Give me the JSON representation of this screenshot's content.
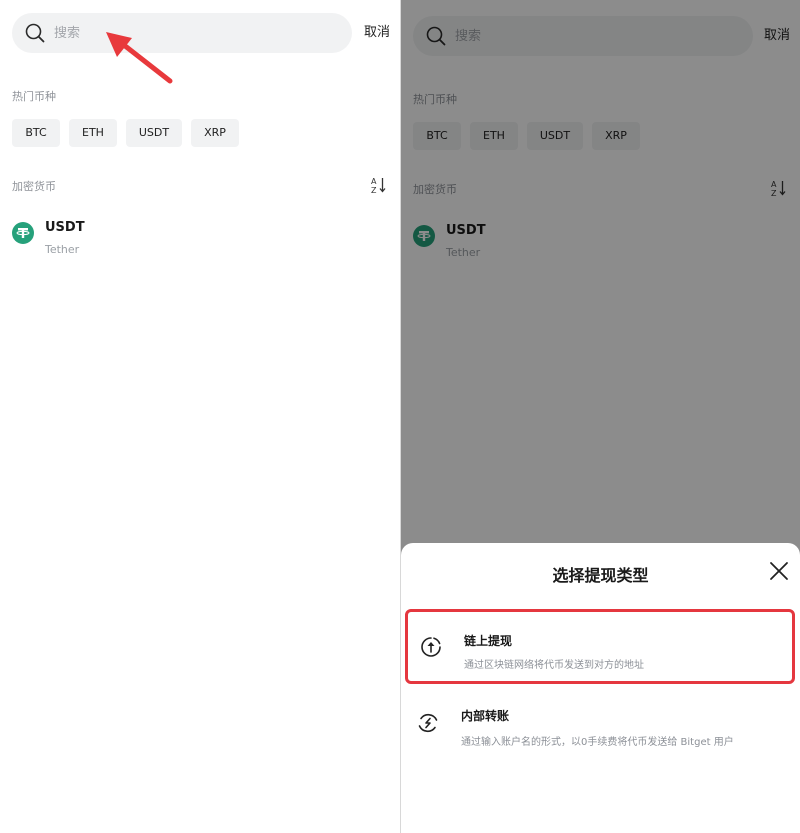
{
  "search": {
    "placeholder": "搜索",
    "cancel_label": "取消"
  },
  "hot": {
    "label": "热门币种",
    "chips": [
      "BTC",
      "ETH",
      "USDT",
      "XRP"
    ]
  },
  "crypto": {
    "label": "加密货币",
    "sort_icon": "sort-az-icon",
    "items": [
      {
        "symbol": "USDT",
        "name": "Tether",
        "logo_letter": "T",
        "logo_color": "#26a17b"
      }
    ]
  },
  "sheet": {
    "title": "选择提现类型",
    "close_icon": "close-icon",
    "options": [
      {
        "title": "链上提现",
        "desc": "通过区块链网络将代币发送到对方的地址",
        "icon": "arrow-up-circle-icon",
        "highlighted": true
      },
      {
        "title": "内部转账",
        "desc": "通过输入账户名的形式，以0手续费将代币发送给 Bitget 用户",
        "icon": "transfer-circle-icon",
        "highlighted": false
      }
    ]
  },
  "colors": {
    "highlight_border": "#e5373f",
    "annotation_arrow": "#e8393c",
    "tether_green": "#26a17b",
    "overlay": "rgba(0,0,0,0.45)"
  }
}
